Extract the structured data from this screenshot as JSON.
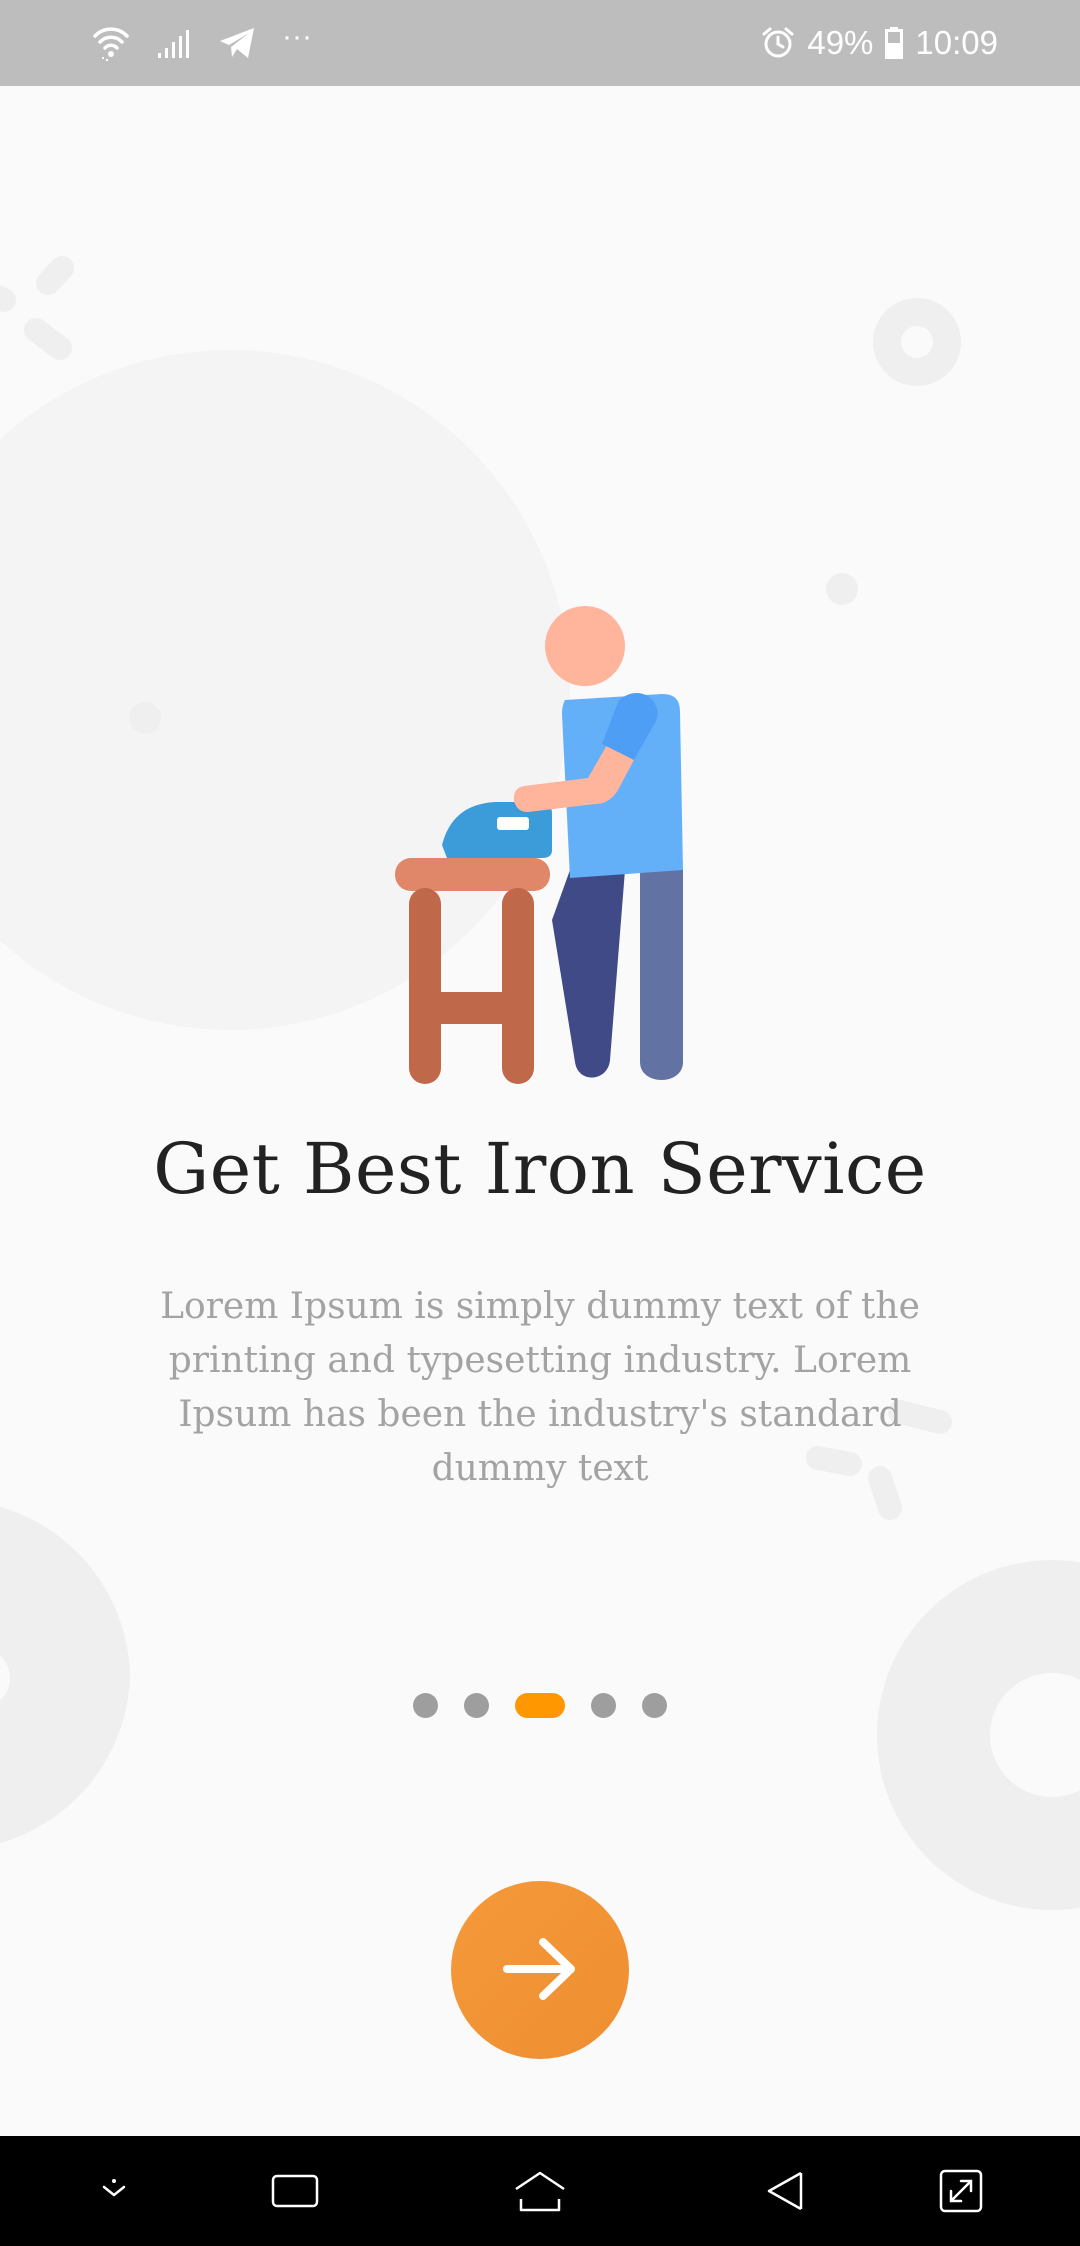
{
  "status_bar": {
    "battery_percent": "49%",
    "time": "10:09",
    "more_indicator": "···",
    "icons": [
      "wifi-icon",
      "signal-icon",
      "telegram-icon",
      "alarm-icon",
      "battery-icon"
    ]
  },
  "onboarding": {
    "title": "Get Best Iron Service",
    "description": "Lorem Ipsum is simply dummy text of the printing and typesetting industry. Lorem Ipsum has been the industry's standard dummy text",
    "illustration": "person-ironing-illustration",
    "page_count": 5,
    "active_page": 3,
    "next_icon": "arrow-right-icon"
  },
  "navigation_bar": {
    "icons": [
      "collapse-icon",
      "recent-apps-icon",
      "home-icon",
      "back-icon",
      "expand-icon"
    ]
  },
  "colors": {
    "accent": "#f39536",
    "indicator_active": "#ff9800",
    "indicator_inactive": "#9e9e9e",
    "title_text": "#222222",
    "description_text": "#a3a3a3",
    "status_bar": "#bdbdbd",
    "background": "#fafafa"
  }
}
